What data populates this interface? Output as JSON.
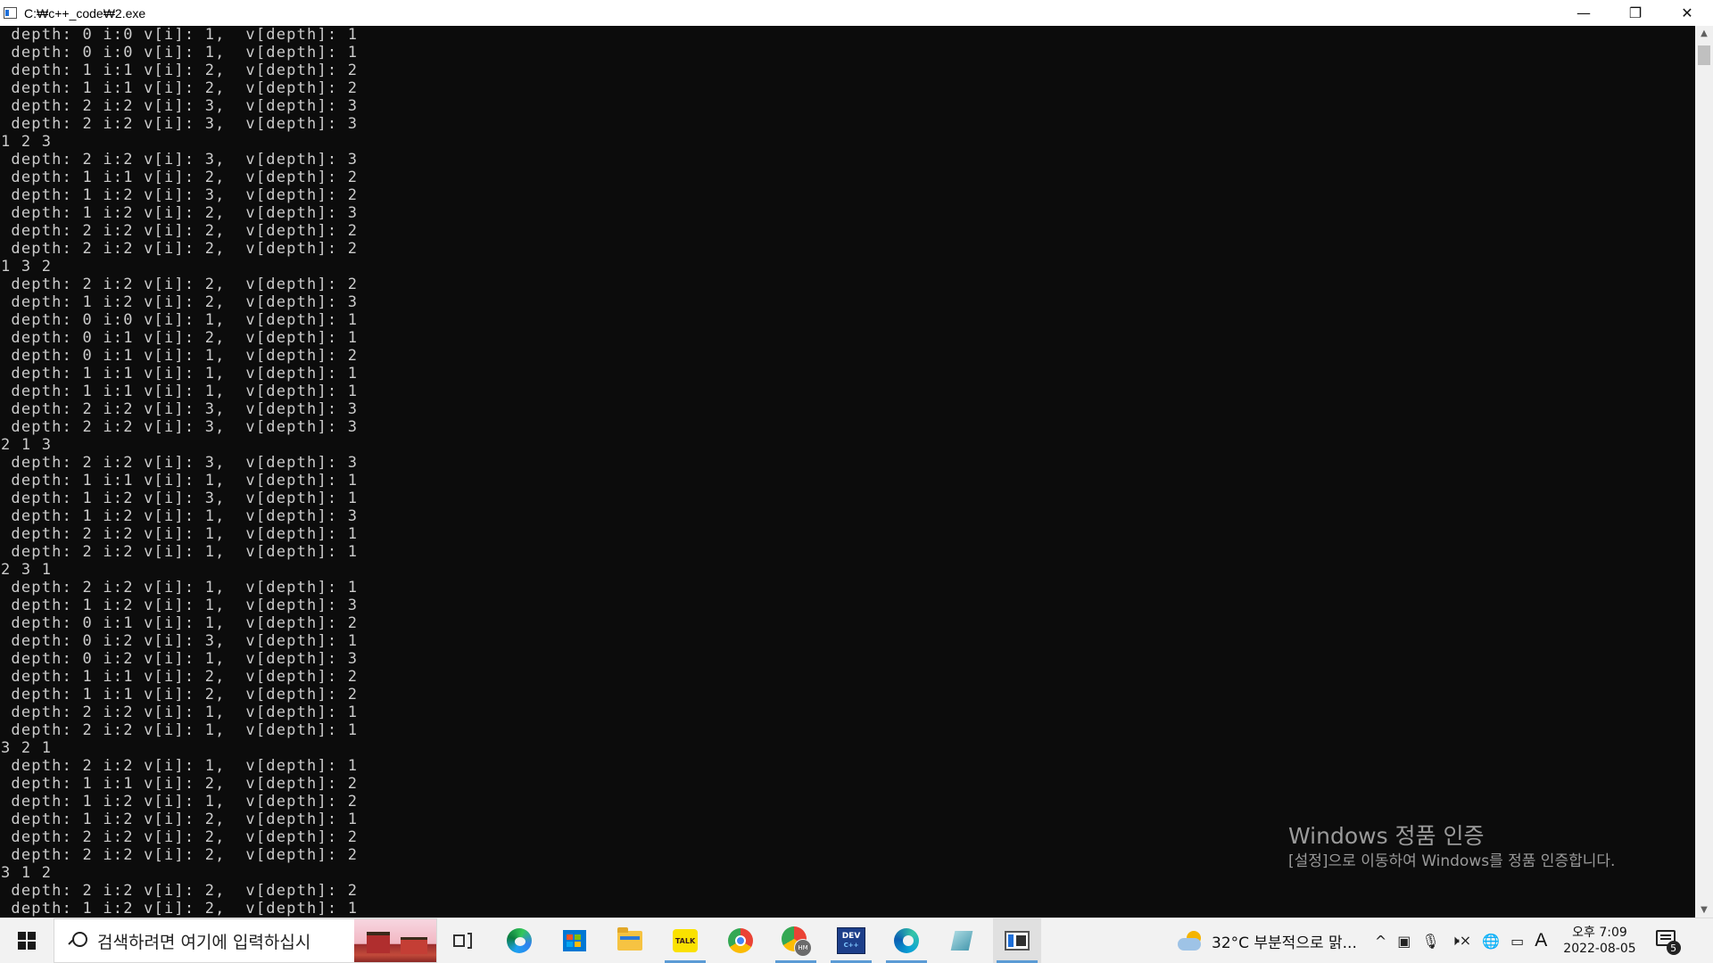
{
  "window": {
    "title": "C:₩c++_code₩2.exe",
    "minimize_glyph": "—",
    "maximize_glyph": "❐",
    "close_glyph": "✕"
  },
  "console": {
    "lines": [
      " depth: 0 i:0 v[i]: 1,  v[depth]: 1",
      " depth: 0 i:0 v[i]: 1,  v[depth]: 1",
      " depth: 1 i:1 v[i]: 2,  v[depth]: 2",
      " depth: 1 i:1 v[i]: 2,  v[depth]: 2",
      " depth: 2 i:2 v[i]: 3,  v[depth]: 3",
      " depth: 2 i:2 v[i]: 3,  v[depth]: 3",
      "1 2 3",
      " depth: 2 i:2 v[i]: 3,  v[depth]: 3",
      " depth: 1 i:1 v[i]: 2,  v[depth]: 2",
      " depth: 1 i:2 v[i]: 3,  v[depth]: 2",
      " depth: 1 i:2 v[i]: 2,  v[depth]: 3",
      " depth: 2 i:2 v[i]: 2,  v[depth]: 2",
      " depth: 2 i:2 v[i]: 2,  v[depth]: 2",
      "1 3 2",
      " depth: 2 i:2 v[i]: 2,  v[depth]: 2",
      " depth: 1 i:2 v[i]: 2,  v[depth]: 3",
      " depth: 0 i:0 v[i]: 1,  v[depth]: 1",
      " depth: 0 i:1 v[i]: 2,  v[depth]: 1",
      " depth: 0 i:1 v[i]: 1,  v[depth]: 2",
      " depth: 1 i:1 v[i]: 1,  v[depth]: 1",
      " depth: 1 i:1 v[i]: 1,  v[depth]: 1",
      " depth: 2 i:2 v[i]: 3,  v[depth]: 3",
      " depth: 2 i:2 v[i]: 3,  v[depth]: 3",
      "2 1 3",
      " depth: 2 i:2 v[i]: 3,  v[depth]: 3",
      " depth: 1 i:1 v[i]: 1,  v[depth]: 1",
      " depth: 1 i:2 v[i]: 3,  v[depth]: 1",
      " depth: 1 i:2 v[i]: 1,  v[depth]: 3",
      " depth: 2 i:2 v[i]: 1,  v[depth]: 1",
      " depth: 2 i:2 v[i]: 1,  v[depth]: 1",
      "2 3 1",
      " depth: 2 i:2 v[i]: 1,  v[depth]: 1",
      " depth: 1 i:2 v[i]: 1,  v[depth]: 3",
      " depth: 0 i:1 v[i]: 1,  v[depth]: 2",
      " depth: 0 i:2 v[i]: 3,  v[depth]: 1",
      " depth: 0 i:2 v[i]: 1,  v[depth]: 3",
      " depth: 1 i:1 v[i]: 2,  v[depth]: 2",
      " depth: 1 i:1 v[i]: 2,  v[depth]: 2",
      " depth: 2 i:2 v[i]: 1,  v[depth]: 1",
      " depth: 2 i:2 v[i]: 1,  v[depth]: 1",
      "3 2 1",
      " depth: 2 i:2 v[i]: 1,  v[depth]: 1",
      " depth: 1 i:1 v[i]: 2,  v[depth]: 2",
      " depth: 1 i:2 v[i]: 1,  v[depth]: 2",
      " depth: 1 i:2 v[i]: 2,  v[depth]: 1",
      " depth: 2 i:2 v[i]: 2,  v[depth]: 2",
      " depth: 2 i:2 v[i]: 2,  v[depth]: 2",
      "3 1 2",
      " depth: 2 i:2 v[i]: 2,  v[depth]: 2",
      " depth: 1 i:2 v[i]: 2,  v[depth]: 1"
    ]
  },
  "watermark": {
    "title": "Windows 정품 인증",
    "subtitle": "[설정]으로 이동하여 Windows를 정품 인증합니다."
  },
  "taskbar": {
    "search_placeholder": "검색하려면 여기에 입력하십시",
    "kakao_label": "TALK",
    "chrome_profile_badge": "HM",
    "devcpp_label": "DEV",
    "devcpp_sub": "C++",
    "weather": "32°C  부분적으로 맑...",
    "tray_chevron": "^",
    "tray_speaker": "🕨×",
    "ime": "A",
    "clock_time": "오후 7:09",
    "clock_date": "2022-08-05",
    "notification_count": "5"
  },
  "colors": {
    "console_bg": "#0c0c0c",
    "console_text": "#cccccc",
    "watermark_text": "#9a9a9a",
    "taskbar_bg": "#f2f2f2",
    "active_indicator": "#5b9bd5"
  }
}
